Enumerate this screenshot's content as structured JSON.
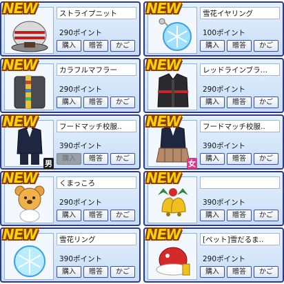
{
  "badge_text": "NEW",
  "button_labels": {
    "buy": "購入",
    "gift": "贈答",
    "cart": "かご"
  },
  "items": [
    {
      "name": "ストライプニット",
      "price": "290ポイント",
      "icon": "striped-knit-hat-icon",
      "gender": "",
      "buy_disabled": false
    },
    {
      "name": "雪花イヤリング",
      "price": "100ポイント",
      "icon": "snowflake-earring-icon",
      "gender": "",
      "buy_disabled": false
    },
    {
      "name": "カラフルマフラー",
      "price": "290ポイント",
      "icon": "colorful-scarf-coat-icon",
      "gender": "",
      "buy_disabled": false
    },
    {
      "name": "レッドラインブラ…",
      "price": "290ポイント",
      "icon": "red-line-jacket-icon",
      "gender": "",
      "buy_disabled": false
    },
    {
      "name": "フードマッチ校服..",
      "price": "390ポイント",
      "icon": "school-uniform-male-icon",
      "gender": "男",
      "buy_disabled": true
    },
    {
      "name": "フードマッチ校服..",
      "price": "390ポイント",
      "icon": "school-uniform-female-icon",
      "gender": "女",
      "buy_disabled": false
    },
    {
      "name": "くまっころ",
      "price": "290ポイント",
      "icon": "bear-costume-icon",
      "gender": "",
      "buy_disabled": false
    },
    {
      "name": "",
      "price": "390ポイント",
      "icon": "christmas-bells-icon",
      "gender": "",
      "buy_disabled": false
    },
    {
      "name": "雪花リング",
      "price": "390ポイント",
      "icon": "snowflake-ring-icon",
      "gender": "",
      "buy_disabled": false
    },
    {
      "name": "[ペット]雪だるま..",
      "price": "290ポイント",
      "icon": "pet-snowman-hat-icon",
      "gender": "",
      "buy_disabled": false
    }
  ]
}
